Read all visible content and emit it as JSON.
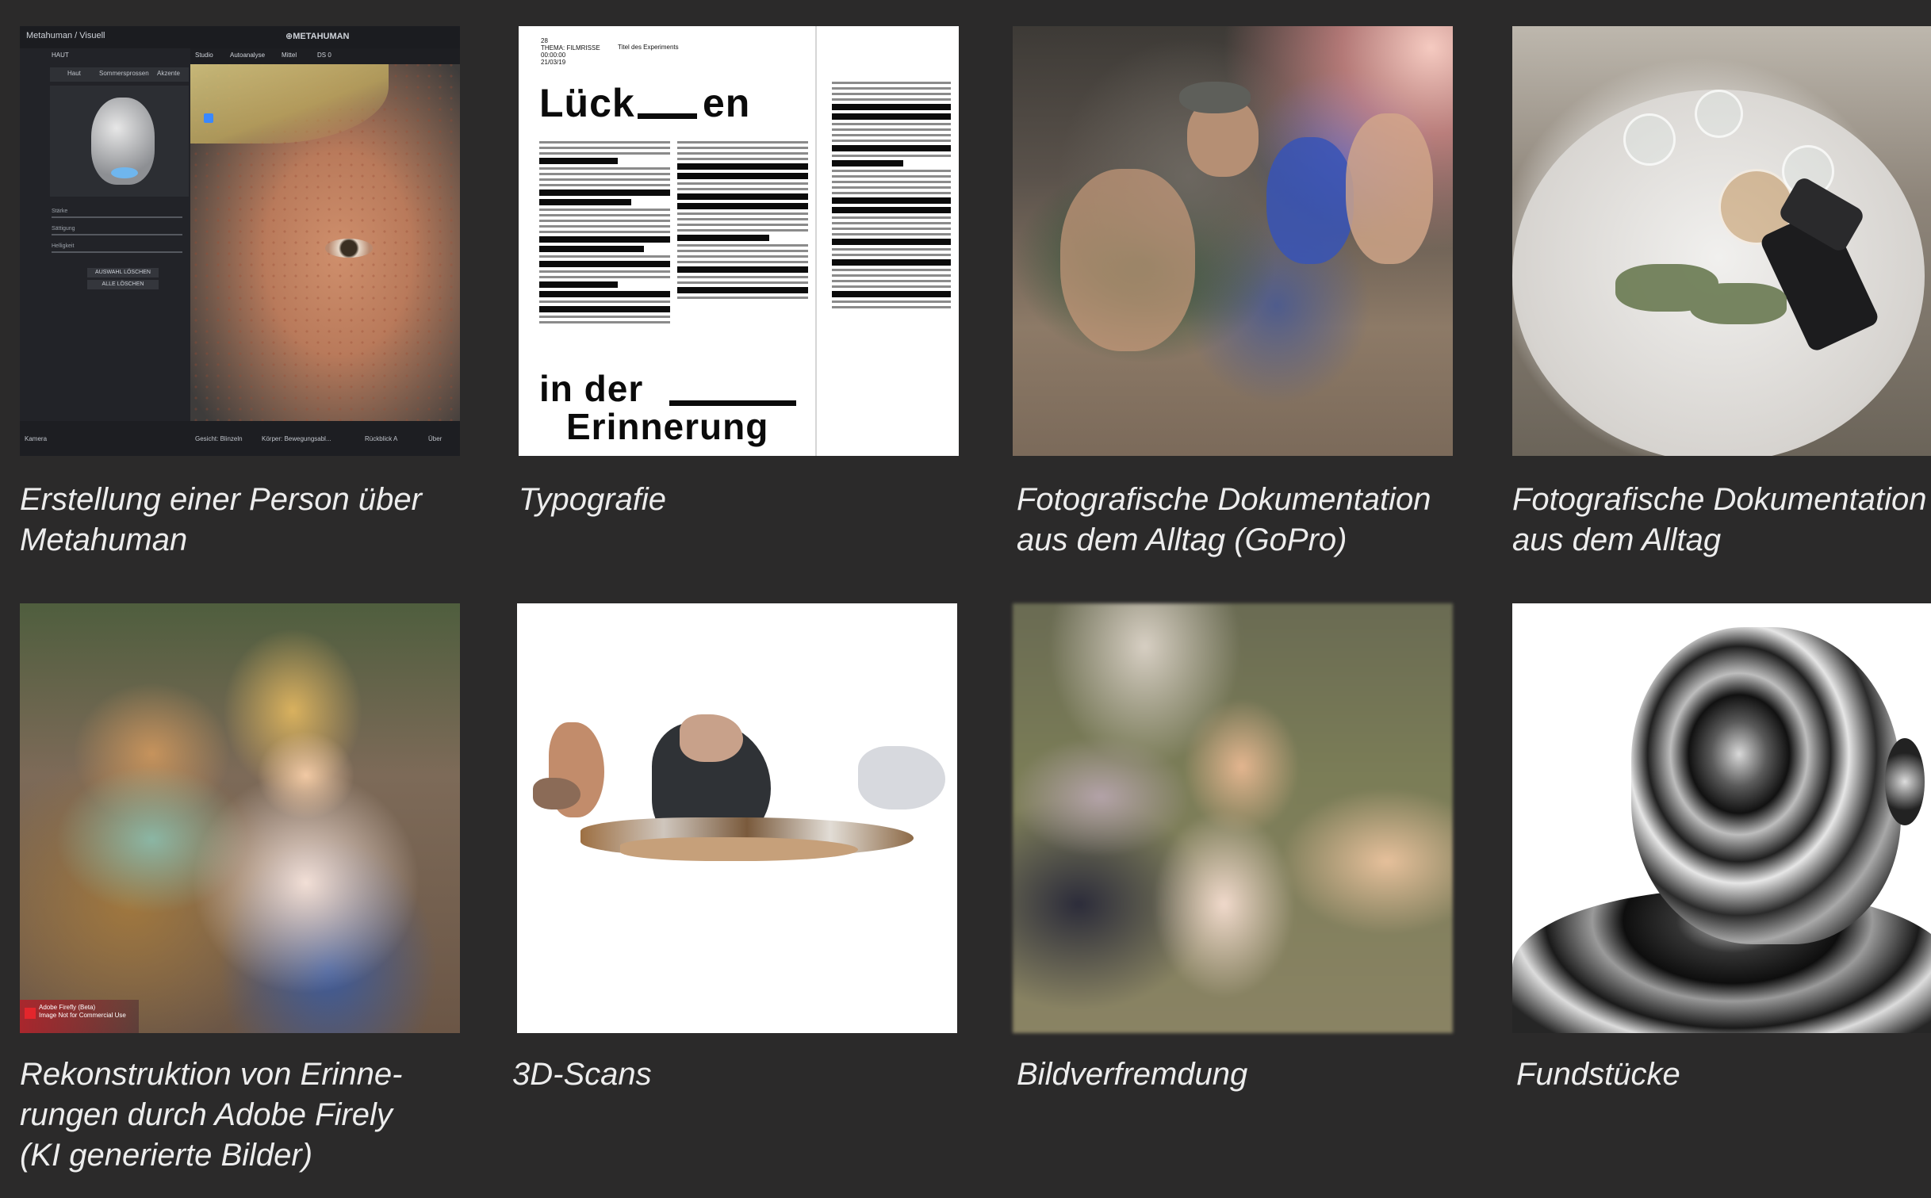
{
  "gallery": {
    "items": [
      {
        "caption": "Erstellung einer Person über\nMetahuman",
        "ui": {
          "window_title": "Metahuman / Visuell",
          "brand": "⊕METAHUMAN",
          "panel_title": "HAUT",
          "tabs": [
            "Haut",
            "Sommersprossen",
            "Akzente"
          ],
          "sliders": [
            "Stärke",
            "Sättigung",
            "Helligkeit"
          ],
          "buttons": [
            "AUSWAHL LÖSCHEN",
            "ALLE LÖSCHEN"
          ],
          "toolbar": [
            "Studio",
            "Autoanalyse",
            "Mittel",
            "DS 0"
          ],
          "bottom": [
            "Kamera",
            "Gesicht: Blinzeln",
            "Körper: Bewegungsabl...",
            "Rückblick A",
            "Über"
          ]
        }
      },
      {
        "caption": "Typografie",
        "spread": {
          "meta_left": "28\nTHEMA: FILMRISSE\n00:00:00\n21/03/19",
          "meta_title": "Titel des Experiments",
          "word_top_a": "Lück",
          "word_top_b": "en",
          "word_bottom_a": "in der",
          "word_bottom_b": "Erinnerung"
        }
      },
      {
        "caption": "Fotografische Dokumentation\naus dem Alltag (GoPro)"
      },
      {
        "caption": "Fotografische Dokumentation\naus dem Alltag"
      },
      {
        "caption": "Rekonstruktion von Erinne-\nrungen durch Adobe Firely\n(KI generierte Bilder)",
        "badge": "Adobe Firefly (Beta)\nImage Not for Commercial Use"
      },
      {
        "caption": "3D-Scans"
      },
      {
        "caption": "Bildverfremdung"
      },
      {
        "caption": "Fundstücke"
      }
    ]
  }
}
